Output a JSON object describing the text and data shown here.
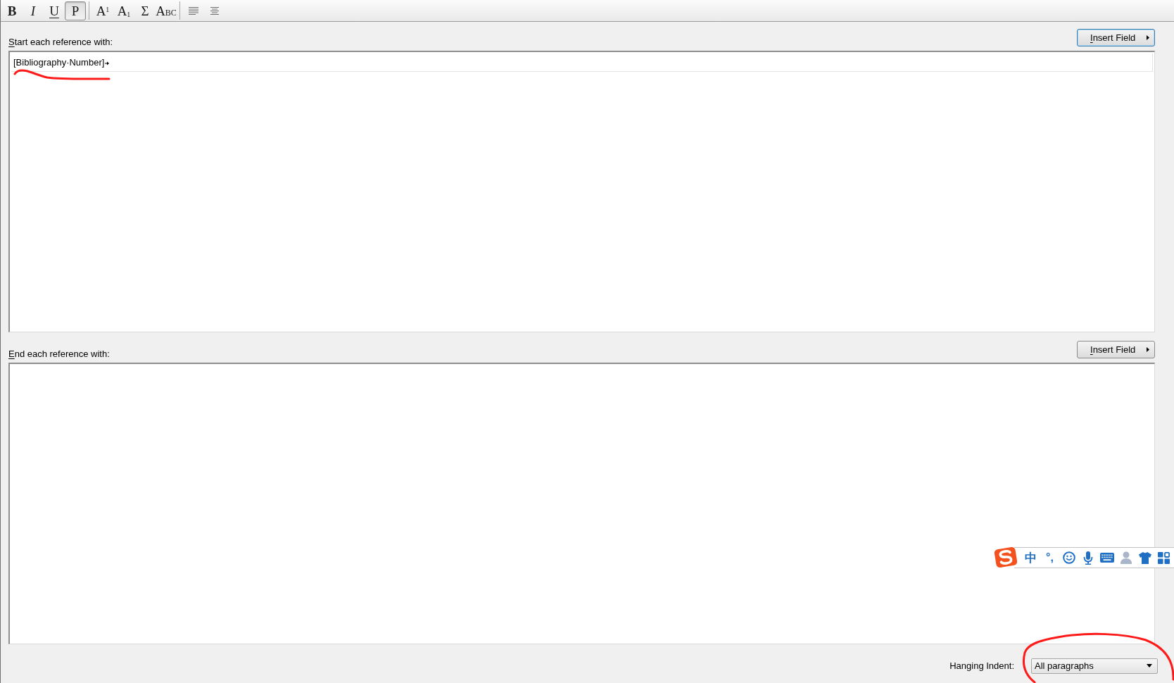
{
  "toolbar": {
    "groups": [
      [
        {
          "kind": "bold",
          "label": "B",
          "on": false
        },
        {
          "kind": "italic",
          "label": "I",
          "on": false
        },
        {
          "kind": "underline",
          "label": "U",
          "on": false
        },
        {
          "kind": "plain",
          "label": "P",
          "on": true
        }
      ],
      [
        {
          "kind": "superscript",
          "label": "A$^{1}$",
          "on": false
        },
        {
          "kind": "subscript",
          "label": "A$_{1}$",
          "on": false
        },
        {
          "kind": "symbol",
          "label": "Σ",
          "on": false
        },
        {
          "kind": "small_caps",
          "label": "ABC",
          "on": false
        }
      ]
    ]
  },
  "sections": [
    {
      "label": "Start each reference with:",
      "access_key": true,
      "button": {
        "label": "Insert Field",
        "access_key": true,
        "focused": true
      },
      "editor": {
        "lines": [
          {
            "text": "[Bibliography·Number]",
            "tab_mark": true
          }
        ]
      }
    },
    {
      "label": "End each reference with:",
      "access_key": true,
      "button": {
        "label": "Insert Field",
        "access_key": true,
        "focused": false
      }
    }
  ],
  "hanging_indent": {
    "label": "Hanging Indent:",
    "value": "All paragraphs"
  },
  "ime_toolbar": {
    "mode": "中",
    "punctuation": "°,"
  }
}
